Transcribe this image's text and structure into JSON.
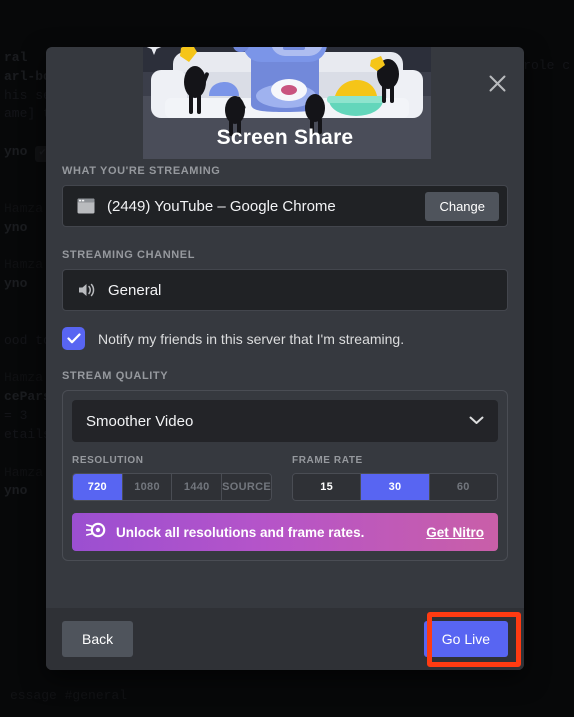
{
  "background": {
    "lines": [
      "ral",
      "arl-bot",
      "his serv",
      "ame] t",
      "yno",
      "",
      "Hamza",
      "yno",
      "Hamza",
      "yno",
      "",
      "ood to",
      "Hamza",
      "cePars",
      "= 3",
      "etails",
      "",
      "Hamza",
      "yno"
    ],
    "right_text": "erole c",
    "bottom_text": "essage #general",
    "badge": "✔ B"
  },
  "modal": {
    "title": "Screen Share",
    "close_label": "✕",
    "source": {
      "section_label": "WHAT YOU'RE STREAMING",
      "icon": "window-icon",
      "value": "(2449) YouTube – Google Chrome",
      "change_button": "Change"
    },
    "channel": {
      "section_label": "STREAMING CHANNEL",
      "icon": "speaker-icon",
      "value": "General"
    },
    "notify": {
      "checked": true,
      "label": "Notify my friends in this server that I'm streaming."
    },
    "quality": {
      "section_label": "STREAM QUALITY",
      "preset": "Smoother Video",
      "resolution": {
        "label": "RESOLUTION",
        "options": [
          {
            "label": "720",
            "state": "active"
          },
          {
            "label": "1080",
            "state": "disabled"
          },
          {
            "label": "1440",
            "state": "disabled"
          },
          {
            "label": "SOURCE",
            "state": "disabled"
          }
        ]
      },
      "frame_rate": {
        "label": "FRAME RATE",
        "options": [
          {
            "label": "15",
            "state": "enabled"
          },
          {
            "label": "30",
            "state": "active"
          },
          {
            "label": "60",
            "state": "disabled"
          }
        ]
      },
      "nitro": {
        "icon": "nitro-wheel-icon",
        "text": "Unlock all resolutions and frame rates.",
        "link": "Get Nitro"
      }
    },
    "footer": {
      "back_label": "Back",
      "go_live_label": "Go Live"
    }
  },
  "colors": {
    "blurple": "#5865F2",
    "modal_bg": "#36393F",
    "footer_bg": "#2F3136",
    "field_bg": "#202225",
    "annotation_red": "#FF3B12",
    "nitro_gradient_start": "#9B4FD1",
    "nitro_gradient_end": "#C95FA8"
  }
}
